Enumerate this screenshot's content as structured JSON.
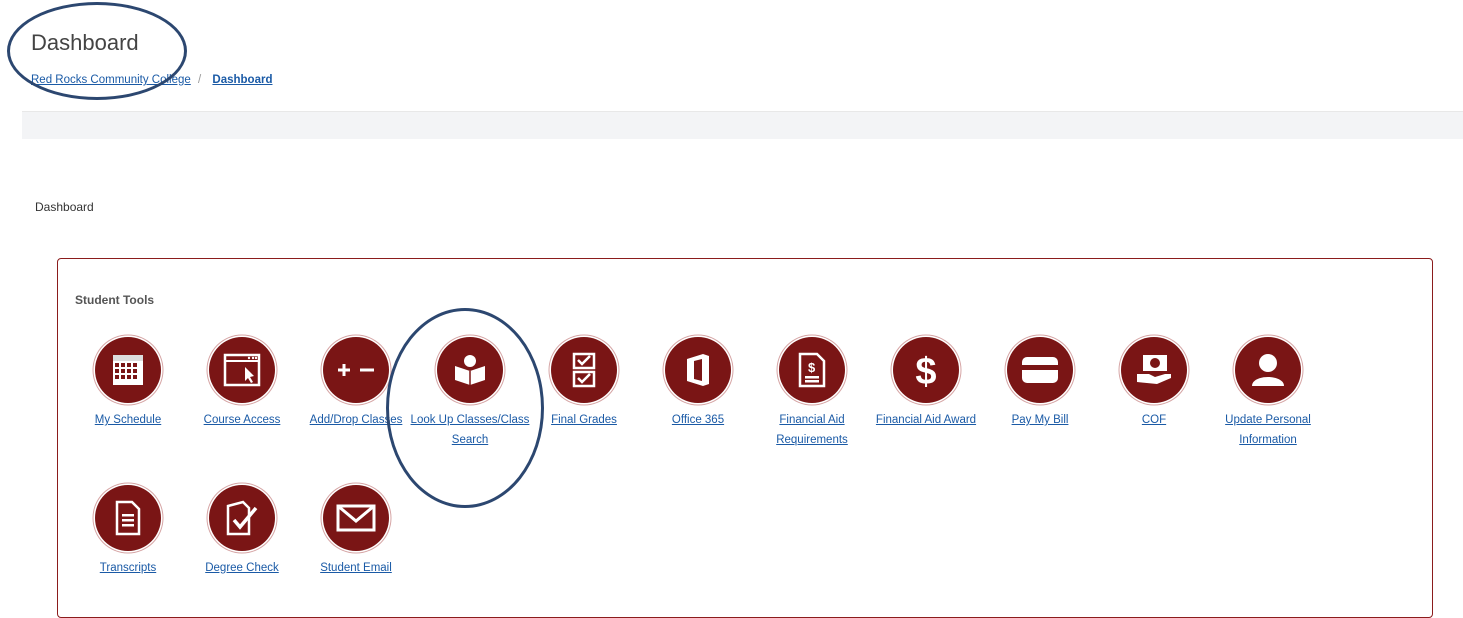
{
  "header": {
    "title": "Dashboard",
    "breadcrumb": {
      "parent": "Red Rocks Community College",
      "separator": "/",
      "current": "Dashboard"
    }
  },
  "main": {
    "section_label": "Dashboard",
    "panel_title": "Student Tools",
    "tools": [
      {
        "label": "My Schedule",
        "icon": "calendar-icon"
      },
      {
        "label": "Course Access",
        "icon": "browser-cursor-icon"
      },
      {
        "label": "Add/Drop Classes",
        "icon": "plus-minus-icon"
      },
      {
        "label": "Look Up Classes/Class Search",
        "icon": "reader-icon"
      },
      {
        "label": "Final Grades",
        "icon": "checklist-icon"
      },
      {
        "label": "Office 365",
        "icon": "office-icon"
      },
      {
        "label": "Financial Aid Requirements",
        "icon": "document-dollar-icon"
      },
      {
        "label": "Financial Aid Award",
        "icon": "dollar-icon"
      },
      {
        "label": "Pay My Bill",
        "icon": "credit-card-icon"
      },
      {
        "label": "COF",
        "icon": "hand-money-icon"
      },
      {
        "label": "Update Personal Information",
        "icon": "user-icon"
      },
      {
        "label": "Transcripts",
        "icon": "document-icon"
      },
      {
        "label": "Degree Check",
        "icon": "document-check-icon"
      },
      {
        "label": "Student Email",
        "icon": "envelope-icon"
      }
    ]
  },
  "colors": {
    "accent": "#7a1515",
    "link": "#1a5aa6",
    "annotation": "#2c4770",
    "panel_border": "#8b1c1c"
  }
}
